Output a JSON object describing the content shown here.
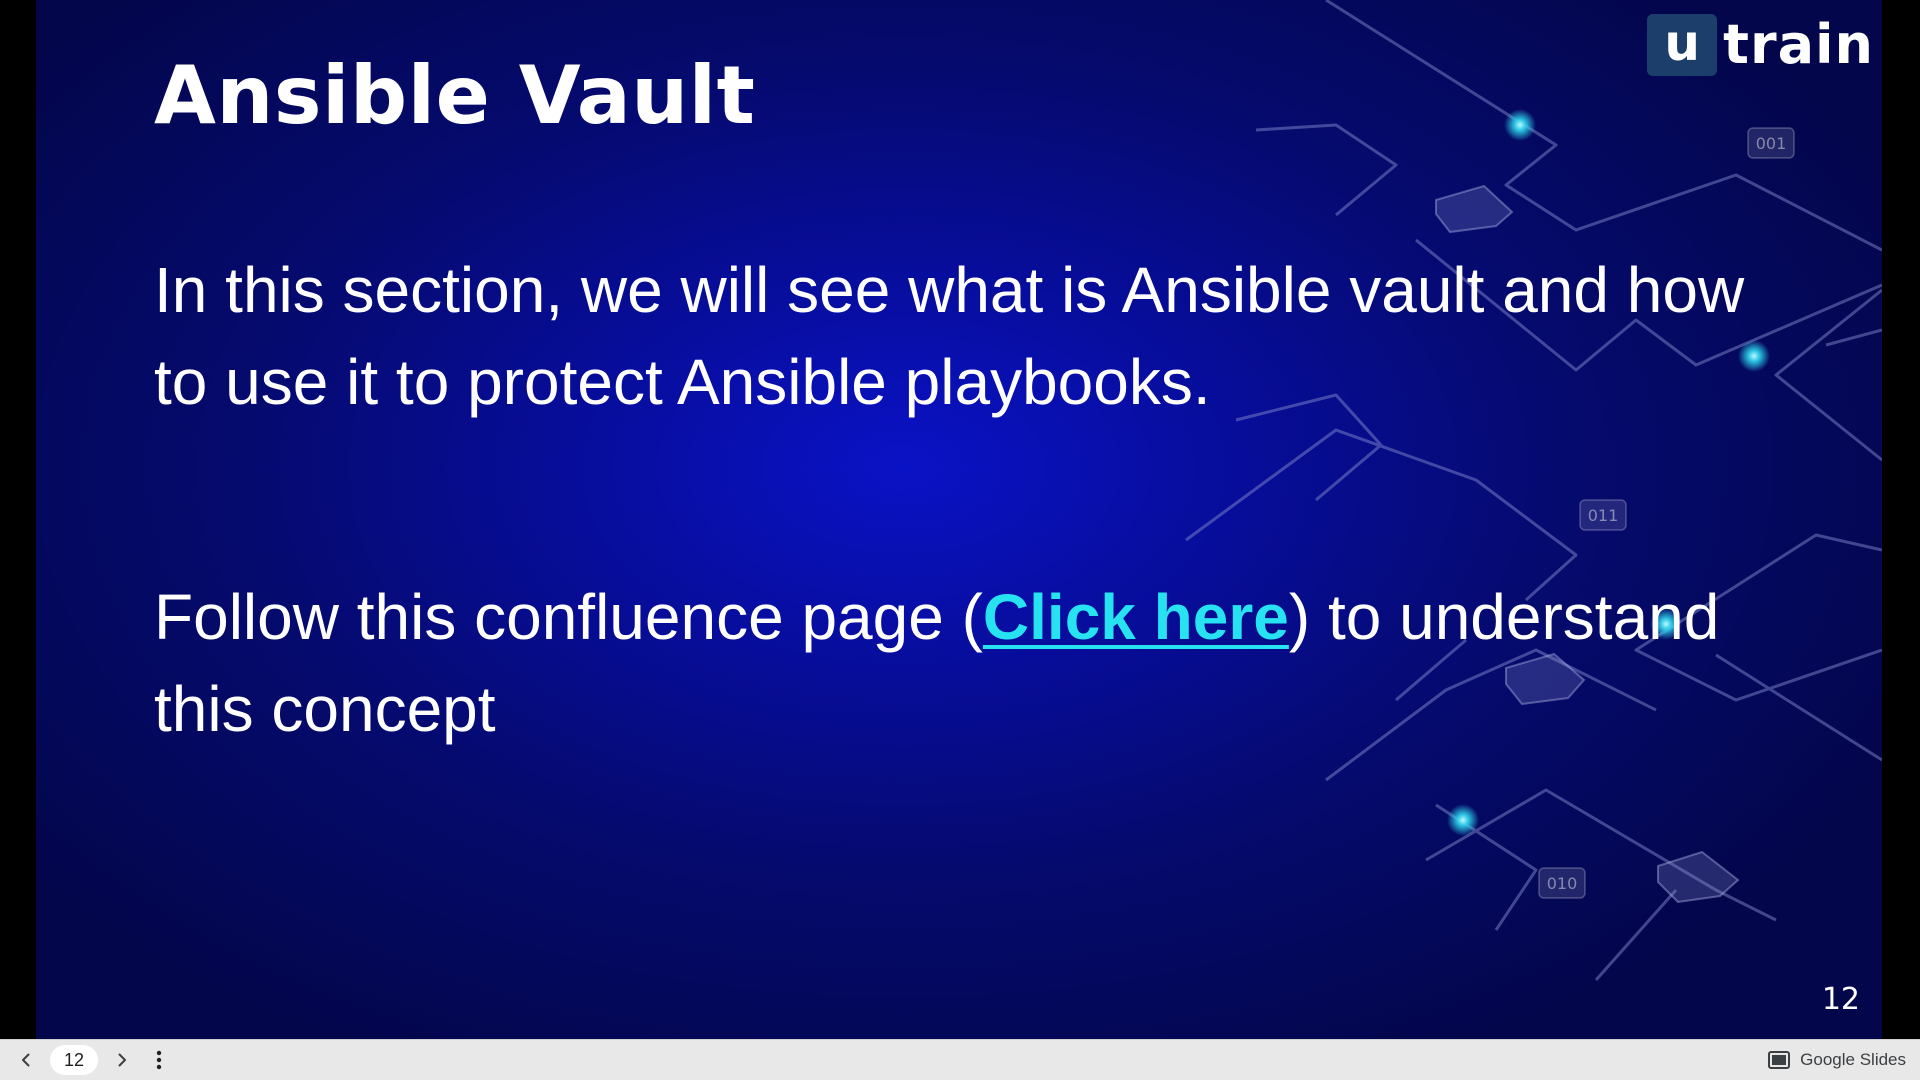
{
  "slide": {
    "title": "Ansible Vault",
    "paragraph_1": "In this section, we will see what is Ansible vault and how to use it to protect Ansible playbooks.",
    "paragraph_2": {
      "before": "Follow this confluence page (",
      "link": "Click here",
      "after": ") to understand this concept"
    },
    "slide_number": "12",
    "logo": {
      "mark": "u",
      "word": "train"
    },
    "decor_labels": [
      "001",
      "011",
      "010"
    ],
    "colors": {
      "background": "#070d9a",
      "link": "#27e3f2",
      "logo_box": "#1b3f6a"
    }
  },
  "viewer": {
    "page_input": "12",
    "brand_label": "Google Slides",
    "icons": {
      "prev": "chevron-left-icon",
      "next": "chevron-right-icon",
      "more": "more-vertical-icon",
      "brand": "slides-icon"
    }
  }
}
